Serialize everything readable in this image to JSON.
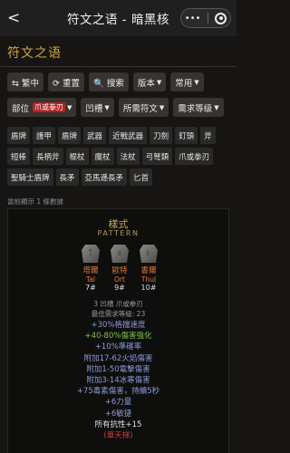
{
  "topbar": {
    "back": "<",
    "title": "符文之语 - 暗黑核",
    "menu": "•••"
  },
  "page_title": "符文之语",
  "controls": {
    "traditional": "⇆ 繁中",
    "reset": "⟳ 重置",
    "search": "🔍 搜索",
    "version": "版本",
    "common": "常用",
    "part": "部位",
    "part_tag": "爪或拳刃",
    "sockets": "凹槽",
    "required_runes": "所需符文",
    "required_level": "需求等级"
  },
  "categories": [
    [
      "盾牌",
      "護甲",
      "盾牌",
      "武器",
      "近戰武器",
      "刀劍",
      "釘頭",
      "斧"
    ],
    [
      "短棒",
      "長柄斧",
      "棍杖",
      "魔杖",
      "法杖",
      "弓弩類",
      "爪或拳刃"
    ],
    [
      "聖騎士盾牌",
      "長矛",
      "亞馬遜長矛",
      "匕首"
    ]
  ],
  "count_text": "當前顯示 1 條數據",
  "card": {
    "name": "樣式",
    "name_en": "PATTERN",
    "runes": [
      {
        "zh": "塔爾",
        "en": "Tal",
        "num": "7#",
        "glyph": "ᛏ"
      },
      {
        "zh": "歐特",
        "en": "Ort",
        "num": "9#",
        "glyph": "ᛟ"
      },
      {
        "zh": "書爾",
        "en": "Thul",
        "num": "10#",
        "glyph": "ᚦ"
      }
    ],
    "info_sockets": "3 凹槽 爪或拳刃",
    "info_level": "最低需求等級: 23",
    "stats": [
      {
        "text": "+30%格擋速度",
        "color": "blue"
      },
      {
        "text": "+40-80%傷害強化",
        "color": "green"
      },
      {
        "text": "+10%準確率",
        "color": "blue"
      },
      {
        "text": "附加17-62火焰傷害",
        "color": "blue"
      },
      {
        "text": "附加1-50電擊傷害",
        "color": "blue"
      },
      {
        "text": "附加3-14冰寒傷害",
        "color": "blue"
      },
      {
        "text": "+75毒素傷害，持續5秒",
        "color": "blue"
      },
      {
        "text": "+6力量",
        "color": "blue"
      },
      {
        "text": "+6敏捷",
        "color": "blue"
      },
      {
        "text": "所有抗性+15",
        "color": "white"
      },
      {
        "text": "(單天梯)",
        "color": "red"
      }
    ]
  }
}
